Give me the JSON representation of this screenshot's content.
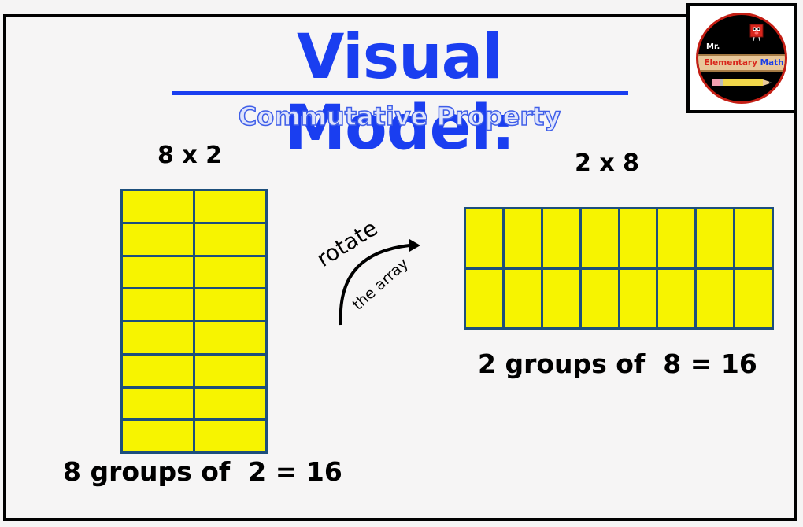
{
  "title": "Visual Model:",
  "subtitle": "Commutative Property",
  "logo": {
    "prefix": "Mr.",
    "word1": "Elementary",
    "word2": "Math"
  },
  "left": {
    "expression": "8 x 2",
    "rows": 8,
    "columns": 2,
    "sentence": "8 groups of  2 = 16"
  },
  "right": {
    "expression": "2 x 8",
    "rows": 2,
    "columns": 8,
    "sentence": "2 groups of  8 = 16"
  },
  "annotation": {
    "line1": "rotate",
    "line2": "the array"
  },
  "colors": {
    "title": "#1a3ef0",
    "cell_fill": "#f7f400",
    "cell_border": "#1d4f7c"
  }
}
